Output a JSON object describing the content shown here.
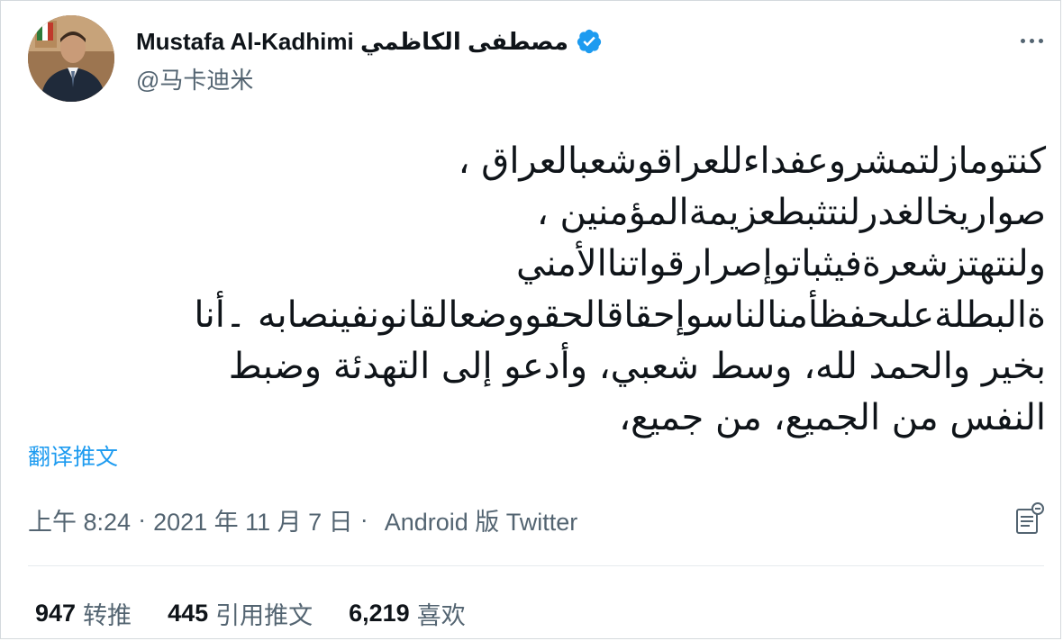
{
  "author": {
    "display_name": "Mustafa Al-Kadhimi مصطفى الكاظمي",
    "handle": "@马卡迪米",
    "verified_icon": "verified-badge-icon",
    "accent": "#1d9bf0"
  },
  "tweet": {
    "lines": [
      "كنتومازلتمشروعفداءللعراقوشعبالعراق ،",
      "صواريخالغدرلنتثبطعزيمةالمؤمنين ،",
      "ولنتهتزشعرةفيثباتوإصرارقواتناالأمني",
      "ةالبطلةعلىحفظأمنالناسوإحقاقالحقووضعالقانونفينصابه ۔أنا",
      "بخير والحمد لله، وسط شعبي، وأدعو إلى التهدئة وضبط",
      "النفس من الجميع، من جميع،"
    ]
  },
  "translate_label": "翻译推文",
  "meta": {
    "time": "上午 8:24",
    "separator": "·",
    "date": "2021 年 11 月 7 日",
    "source": "Android 版 Twitter"
  },
  "stats": {
    "retweets": {
      "count": "947",
      "label": "转推"
    },
    "quotes": {
      "count": "445",
      "label": "引用推文"
    },
    "likes": {
      "count": "6,219",
      "label": "喜欢"
    }
  },
  "icons": {
    "more": "more-options-icon",
    "analytics": "tweet-analytics-icon"
  }
}
